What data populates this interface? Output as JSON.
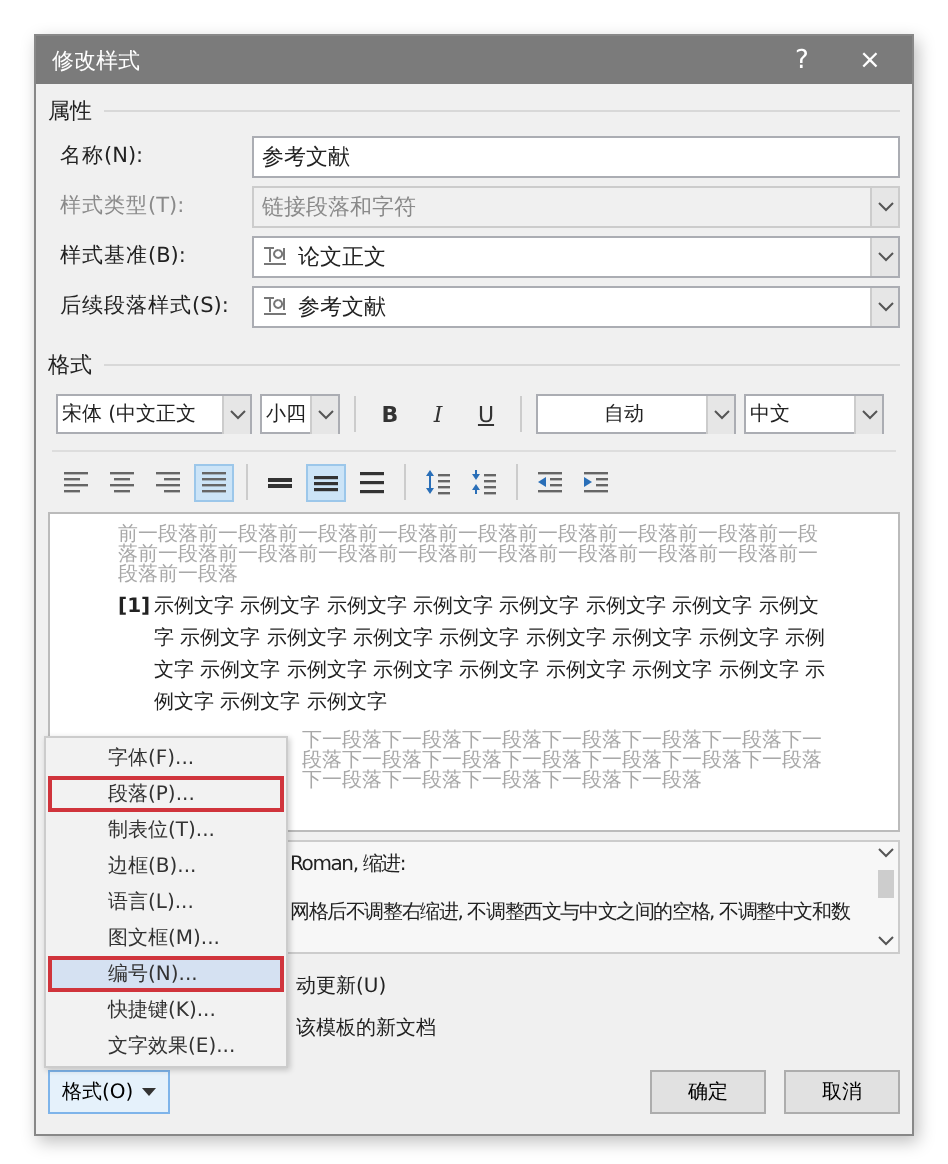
{
  "window": {
    "title": "修改样式",
    "help": "?",
    "close": "×"
  },
  "properties": {
    "heading": "属性",
    "fields": [
      {
        "label": "名称(N):",
        "value": "参考文献",
        "kind": "text",
        "disabled": false
      },
      {
        "label": "样式类型(T):",
        "value": "链接段落和字符",
        "kind": "combo",
        "disabled": true
      },
      {
        "label": "样式基准(B):",
        "value": "论文正文",
        "kind": "style-combo",
        "disabled": false
      },
      {
        "label": "后续段落样式(S):",
        "value": "参考文献",
        "kind": "style-combo",
        "disabled": false
      }
    ]
  },
  "format": {
    "heading": "格式",
    "font": "宋体 (中文正文",
    "size": "小四",
    "style_buttons": [
      {
        "label": "B",
        "kind": "bold"
      },
      {
        "label": "I",
        "kind": "italic"
      },
      {
        "label": "U",
        "kind": "underline"
      }
    ],
    "font_color": "自动",
    "language": "中文",
    "paragraph_buttons": [
      {
        "kind": "align-left",
        "selected": false
      },
      {
        "kind": "align-center",
        "selected": false
      },
      {
        "kind": "align-right",
        "selected": false
      },
      {
        "kind": "justify",
        "selected": true
      },
      {
        "kind": "single-spacing",
        "selected": false
      },
      {
        "kind": "one-half-spacing",
        "selected": true
      },
      {
        "kind": "double-spacing",
        "selected": false
      },
      {
        "kind": "space-before",
        "selected": false
      },
      {
        "kind": "space-after",
        "selected": false
      },
      {
        "kind": "outdent",
        "selected": false
      },
      {
        "kind": "indent",
        "selected": false
      }
    ]
  },
  "preview": {
    "previous": "前一段落前一段落前一段落前一段落前一段落前一段落前一段落前一段落前一段落前一段落前一段落前一段落前一段落前一段落前一段落前一段落前一段落前一段落前一段落",
    "number": "[1]",
    "sample": "示例文字 示例文字 示例文字 示例文字 示例文字 示例文字 示例文字 示例文字 示例文字 示例文字 示例文字 示例文字 示例文字 示例文字 示例文字 示例文字 示例文字 示例文字 示例文字 示例文字 示例文字 示例文字 示例文字 示例文字 示例文字 示例文字",
    "next": "下一段落下一段落下一段落下一段落下一段落下一段落下一段落下一段落下一段落下一段落下一段落下一段落下一段落下一段落下一段落下一段落下一段落下一段落"
  },
  "description": [
    "Roman, 缩进:",
    "网格后不调整右缩进, 不调整西文与中文之间的空格, 不调整中文和数"
  ],
  "options": [
    "动更新(U)",
    "该模板的新文档"
  ],
  "format_button": {
    "label": "格式(O)",
    "selected": true
  },
  "buttons": [
    "确定",
    "取消"
  ],
  "menu": {
    "items": [
      {
        "label": "字体(F)...",
        "selected": false,
        "annotated": false
      },
      {
        "label": "段落(P)...",
        "selected": false,
        "annotated": true
      },
      {
        "label": "制表位(T)...",
        "selected": false,
        "annotated": false
      },
      {
        "label": "边框(B)...",
        "selected": false,
        "annotated": false
      },
      {
        "label": "语言(L)...",
        "selected": false,
        "annotated": false
      },
      {
        "label": "图文框(M)...",
        "selected": false,
        "annotated": false
      },
      {
        "label": "编号(N)...",
        "selected": true,
        "annotated": true
      },
      {
        "label": "快捷键(K)...",
        "selected": false,
        "annotated": false
      },
      {
        "label": "文字效果(E)...",
        "selected": false,
        "annotated": false
      }
    ]
  }
}
